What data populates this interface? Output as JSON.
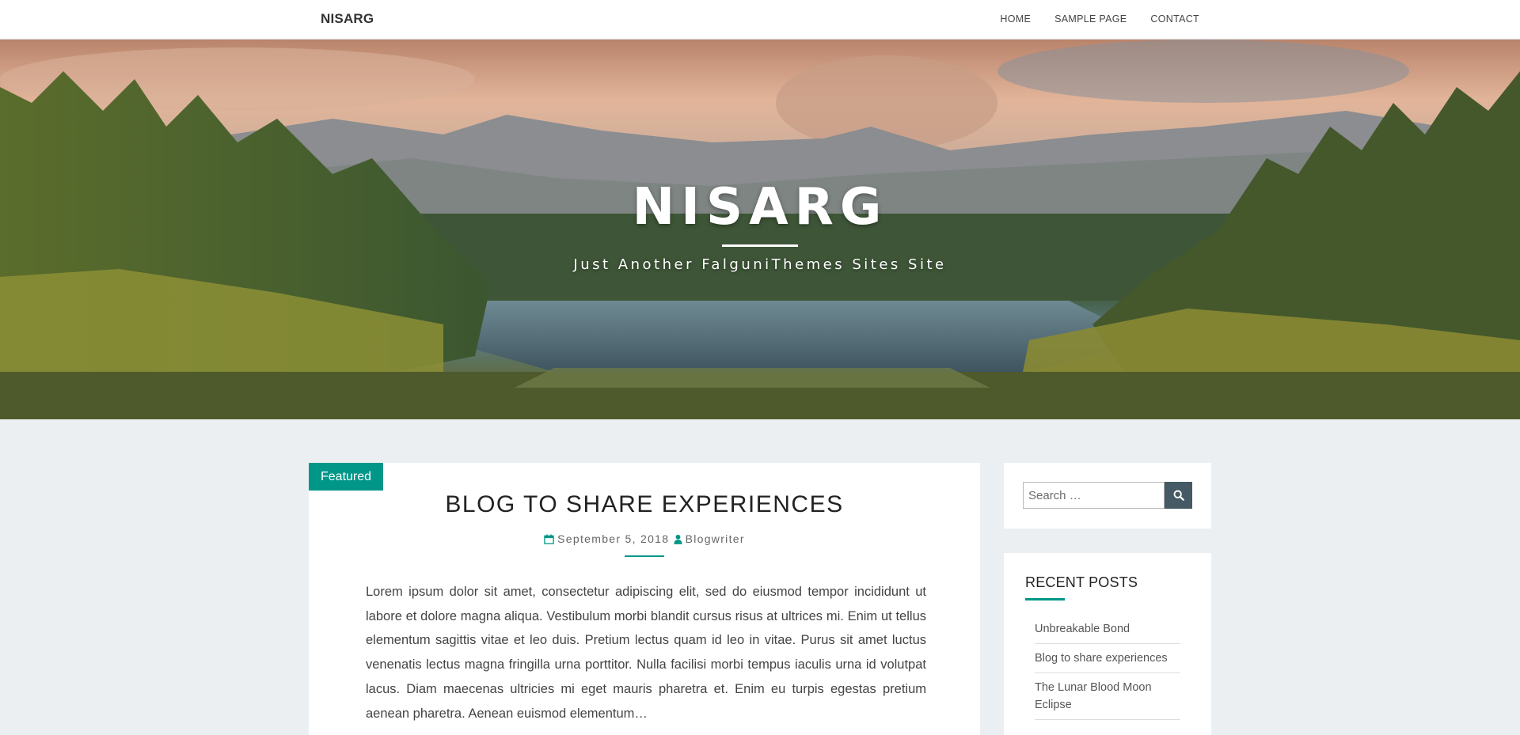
{
  "navbar": {
    "brand": "NISARG",
    "menu": [
      {
        "label": "HOME"
      },
      {
        "label": "SAMPLE PAGE"
      },
      {
        "label": "CONTACT"
      }
    ]
  },
  "hero": {
    "title": "NISARG",
    "tagline": "Just Another FalguniThemes Sites Site"
  },
  "post": {
    "badge": "Featured",
    "title": "BLOG TO SHARE EXPERIENCES",
    "date": "September 5, 2018",
    "author": "Blogwriter",
    "excerpt": "Lorem ipsum dolor sit amet, consectetur adipiscing elit, sed do eiusmod tempor incididunt ut labore et dolore magna aliqua. Vestibulum morbi blandit cursus risus at ultrices mi. Enim ut tellus elementum sagittis vitae et leo duis. Pretium lectus quam id leo in vitae. Purus sit amet luctus venenatis lectus magna fringilla urna porttitor. Nulla facilisi morbi tempus iaculis urna id volutpat lacus. Diam maecenas ultricies mi eget mauris pharetra et. Enim eu turpis egestas pretium aenean pharetra. Aenean euismod elementum…"
  },
  "sidebar": {
    "search": {
      "placeholder": "Search …",
      "button_icon": "search-icon"
    },
    "recent_posts": {
      "title": "RECENT POSTS",
      "items": [
        {
          "label": "Unbreakable Bond"
        },
        {
          "label": "Blog to share experiences"
        },
        {
          "label": "The Lunar Blood Moon Eclipse"
        }
      ]
    }
  },
  "colors": {
    "accent": "#009688",
    "search_button": "#455a64",
    "page_background": "#eceff1"
  }
}
